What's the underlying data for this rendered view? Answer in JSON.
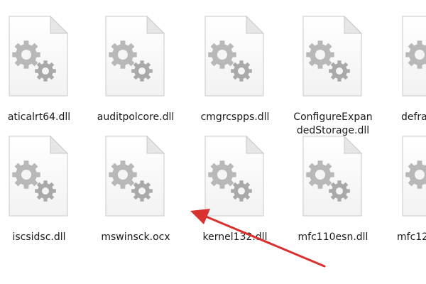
{
  "files": [
    {
      "name": "aticalrt64.dll",
      "icon": "gear-file-icon"
    },
    {
      "name": "auditpolcore.dll",
      "icon": "gear-file-icon"
    },
    {
      "name": "cmgrcspps.dll",
      "icon": "gear-file-icon"
    },
    {
      "name": "ConfigureExpan\ndedStorage.dll",
      "icon": "gear-file-icon"
    },
    {
      "name": "defra",
      "icon": "gear-file-icon"
    },
    {
      "name": "iscsidsc.dll",
      "icon": "gear-file-icon"
    },
    {
      "name": "mswinsck.ocx",
      "icon": "gear-file-icon"
    },
    {
      "name": "kernel132.dll",
      "icon": "gear-file-icon"
    },
    {
      "name": "mfc110esn.dll",
      "icon": "gear-file-icon"
    },
    {
      "name": "mfc12",
      "icon": "gear-file-icon"
    }
  ],
  "annotation": {
    "icon": "red-arrow-icon",
    "color": "#d9312f"
  }
}
